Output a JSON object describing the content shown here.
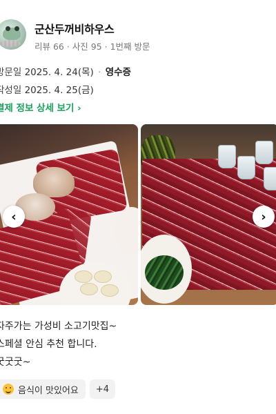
{
  "store": {
    "name": "군산두꺼비하우스",
    "meta": "리뷰 66 · 사진 95 · 1번째 방문"
  },
  "visit": {
    "label": "방문일",
    "date": "2025. 4. 24(목)",
    "separator": "·",
    "receipt": "영수증"
  },
  "written": {
    "label": "작성일",
    "date": "2025. 4. 25(금)"
  },
  "payment_link": {
    "label": "결제 정보 상세 보기",
    "icon": "chevron-right-icon"
  },
  "photos": {
    "prev_icon": "‹",
    "next_icon": "›"
  },
  "review": {
    "lines": [
      "자주가는 가성비 소고기맛집~",
      "스페셜 안심 추천 합니다.",
      "굿굿굿~"
    ]
  },
  "tags": {
    "first": "음식이 맛있어요",
    "more": "+4"
  },
  "colors": {
    "accent_green": "#19a35c",
    "tag_bg": "#f2f2f2"
  }
}
